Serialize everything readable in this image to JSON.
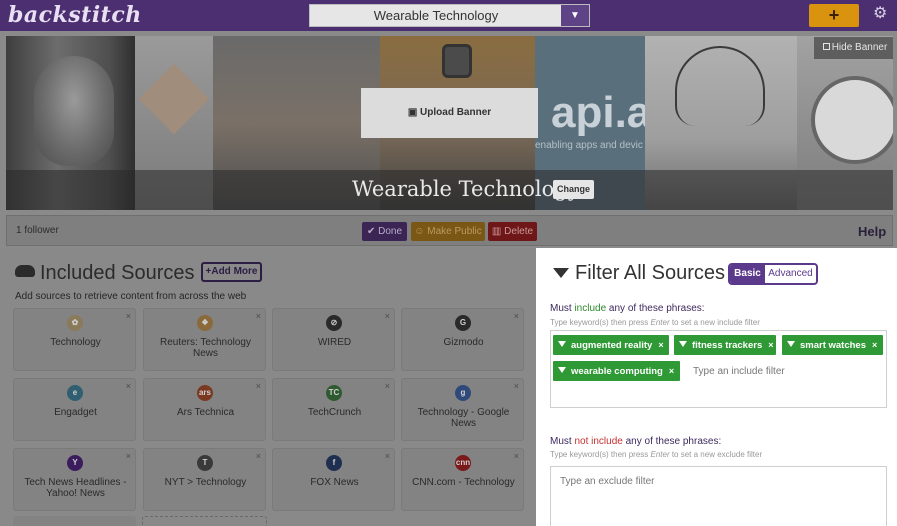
{
  "app": {
    "logo": "backstitch"
  },
  "topbar": {
    "feed_selected": "Wearable Technology",
    "add_label": "+",
    "icons": {
      "caret": "chevron-down-icon",
      "settings": "gear-icon"
    }
  },
  "banner": {
    "title": "Wearable Technology",
    "change_label": "Change",
    "upload_label": "Upload Banner",
    "hide_label": "Hide Banner",
    "api_tile_text": "api.a",
    "api_tile_sub": "enabling apps and devic"
  },
  "actions": {
    "followers": "1 follower",
    "done_label": "Done",
    "public_label": "Make Public",
    "delete_label": "Delete",
    "help_label": "Help"
  },
  "sources": {
    "title": "Included Sources",
    "add_more_label": "+Add More",
    "subtitle": "Add sources to retrieve content from across the web",
    "items": [
      {
        "name": "Technology",
        "icon": "nbc-icon",
        "glyph": "✿",
        "color": "#8a7a5a"
      },
      {
        "name": "Reuters: Technology News",
        "icon": "reuters-icon",
        "glyph": "❖",
        "color": "#8a6a3a"
      },
      {
        "name": "WIRED",
        "icon": "wired-icon",
        "glyph": "⊘",
        "color": "#2a2a2a"
      },
      {
        "name": "Gizmodo",
        "icon": "gizmodo-icon",
        "glyph": "G",
        "color": "#2a2a2a"
      },
      {
        "name": "Engadget",
        "icon": "engadget-icon",
        "glyph": "e",
        "color": "#2f5f70"
      },
      {
        "name": "Ars Technica",
        "icon": "ars-technica-icon",
        "glyph": "ars",
        "color": "#7a3a22"
      },
      {
        "name": "TechCrunch",
        "icon": "techcrunch-icon",
        "glyph": "TC",
        "color": "#2f5a2f"
      },
      {
        "name": "Technology - Google News",
        "icon": "google-news-icon",
        "glyph": "g",
        "color": "#2f4a7a"
      },
      {
        "name": "Tech News Headlines - Yahoo! News",
        "icon": "yahoo-icon",
        "glyph": "Y",
        "color": "#3b1d5e"
      },
      {
        "name": "NYT > Technology",
        "icon": "nyt-icon",
        "glyph": "T",
        "color": "#3a3a3a"
      },
      {
        "name": "FOX News",
        "icon": "fox-news-icon",
        "glyph": "f",
        "color": "#1f2f50"
      },
      {
        "name": "CNN.com - Technology",
        "icon": "cnn-icon",
        "glyph": "cnn",
        "color": "#7a1a1a"
      }
    ],
    "remove_glyph": "×"
  },
  "filter": {
    "title": "Filter All Sources",
    "mode_basic": "Basic",
    "mode_advanced": "Advanced",
    "include": {
      "label_pre": "Must ",
      "label_key": "include",
      "label_post": " any of these phrases:",
      "hint_pre": "Type keyword(s) then press ",
      "hint_key": "Enter",
      "hint_post": " to set a new include filter",
      "chips": [
        "augmented reality",
        "fitness trackers",
        "smart watches",
        "wearable computing"
      ],
      "placeholder": "Type an include filter"
    },
    "exclude": {
      "label_pre": "Must ",
      "label_key": "not include",
      "label_post": " any of these phrases:",
      "hint_pre": "Type keyword(s) then press ",
      "hint_key": "Enter",
      "hint_post": " to set a new exclude filter",
      "placeholder": "Type an exclude filter"
    },
    "colors": {
      "accent": "#5b3a8c",
      "chip": "#2f9a35",
      "include": "#2c8a2c",
      "exclude": "#c62f2f"
    }
  }
}
